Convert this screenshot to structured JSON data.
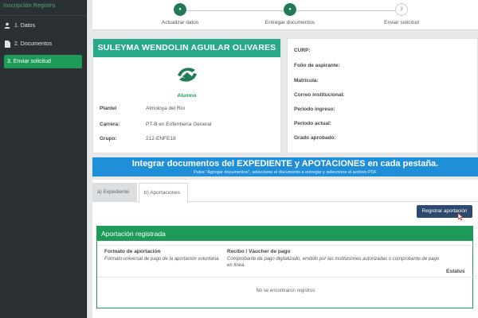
{
  "sidebar": {
    "header": "Inscripción Registro",
    "items": [
      {
        "label": "1. Datos",
        "icon": "user-icon"
      },
      {
        "label": "2. Documentos",
        "icon": "file-icon"
      },
      {
        "label": "3. Enviar solicitud",
        "icon": ""
      }
    ]
  },
  "stepper": {
    "steps": [
      {
        "label": "Actualizar datos",
        "status": "done",
        "marker": "●"
      },
      {
        "label": "Entregar documentos",
        "status": "done",
        "marker": "●"
      },
      {
        "label": "Enviar solicitud",
        "status": "pending",
        "marker": "3"
      }
    ]
  },
  "profile": {
    "name": "SULEYMA WENDOLIN AGUILAR OLIVARES",
    "role": "Alumno",
    "rows": [
      {
        "key": "Plantel",
        "value": "Almoloya del Río"
      },
      {
        "key": "Carrera:",
        "value": "PT-B en Enfermería General"
      },
      {
        "key": "Grupo:",
        "value": "212-ENFE18"
      }
    ]
  },
  "info": {
    "rows": [
      "CURP:",
      "Folio de aspirante:",
      "Matrícula:",
      "Correo institucional:",
      "Periodo ingreso:",
      "Periodo actual:",
      "Grado aprobado:"
    ]
  },
  "banner": {
    "title": "Integrar documentos del EXPEDIENTE y APOTACIONES en cada pestaña.",
    "subtitle": "Pulse \"Agregar documentos\", seleccione el documento a entregar y seleccione el archivo PDF"
  },
  "tabs": [
    "a) Expediente",
    "b) Aportaciones"
  ],
  "actions": {
    "register_label": "Registrar aportación"
  },
  "aportacion": {
    "header": "Aportación registrada",
    "columns": [
      {
        "title": "Formato de aportación",
        "desc": "Formato universal de pago de la aportación voluntaria."
      },
      {
        "title": "Recibo / Váucher de pago",
        "desc": "Comprobante de pago digitalizado, emitido por las instituciones autorizadas o comprobante de pago en línea."
      },
      {
        "title": "Estatus",
        "desc": ""
      }
    ],
    "empty_text": "No se encontraron registros"
  },
  "colors": {
    "accent_green": "#1e9a59",
    "teal": "#27a98a",
    "banner_blue": "#1f8fd9",
    "button_navy": "#2c4a6e"
  }
}
